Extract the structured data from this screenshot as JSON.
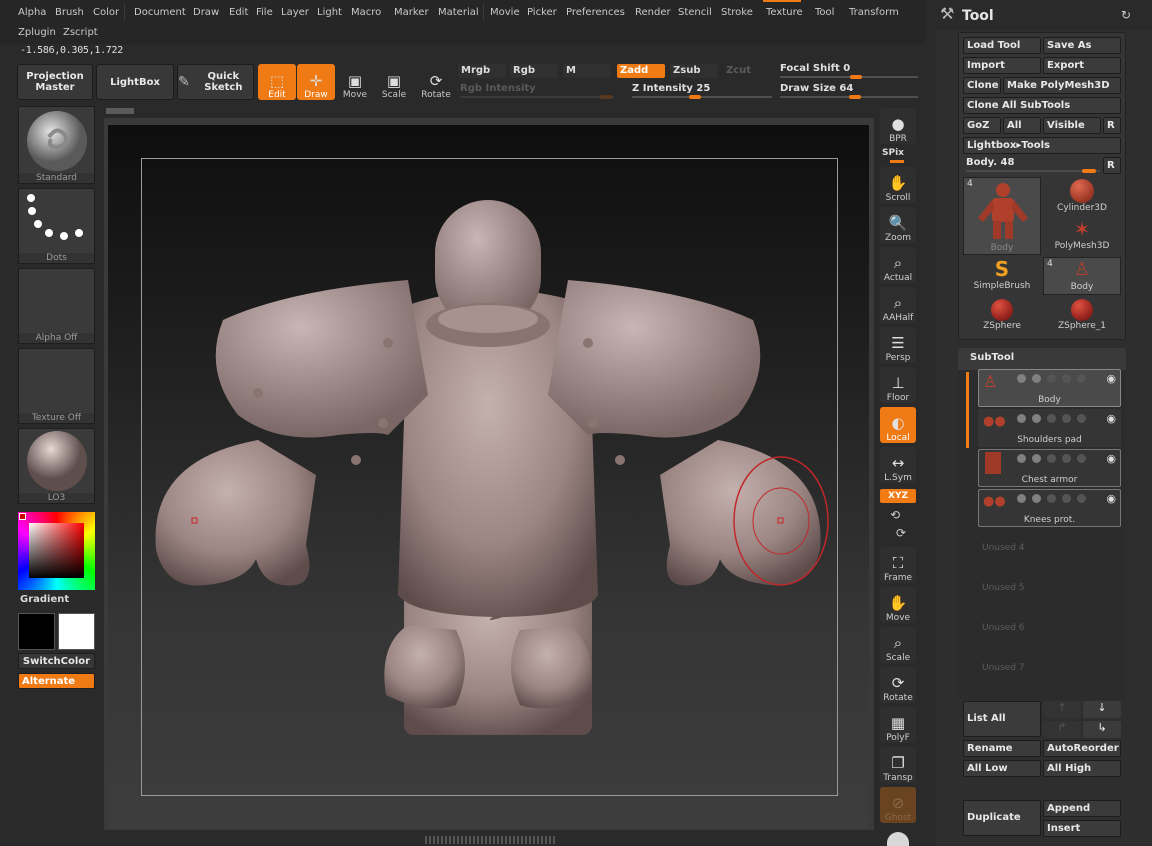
{
  "menu": [
    "Alpha",
    "Brush",
    "Color",
    "Document",
    "Draw",
    "Edit",
    "File",
    "Layer",
    "Light",
    "Macro",
    "Marker",
    "Material",
    "Movie",
    "Picker",
    "Preferences",
    "Render",
    "Stencil",
    "Stroke",
    "Texture",
    "Tool",
    "Transform",
    "Zplugin",
    "Zscript"
  ],
  "coords": "-1.586,0.305,1.722",
  "toolbar": {
    "projection_master": "Projection Master",
    "lightbox": "LightBox",
    "quick_sketch": "Quick Sketch",
    "edit": "Edit",
    "draw": "Draw",
    "move": "Move",
    "scale": "Scale",
    "rotate": "Rotate",
    "mrgb": "Mrgb",
    "rgb": "Rgb",
    "m": "M",
    "zadd": "Zadd",
    "zsub": "Zsub",
    "zcut": "Zcut",
    "rgb_intensity": "Rgb Intensity",
    "z_intensity_label": "Z Intensity",
    "z_intensity_value": "25",
    "focal_shift_label": "Focal Shift",
    "focal_shift_value": "0",
    "draw_size_label": "Draw Size",
    "draw_size_value": "64"
  },
  "left_shelf": {
    "brush": "Standard",
    "stroke": "Dots",
    "alpha": "Alpha Off",
    "texture": "Texture Off",
    "material": "LO3",
    "gradient": "Gradient",
    "switch_color": "SwitchColor",
    "alternate": "Alternate"
  },
  "right_shelf": [
    "BPR",
    "SPix",
    "Scroll",
    "Zoom",
    "Actual",
    "AAHalf",
    "Persp",
    "Floor",
    "Local",
    "L.Sym",
    "XYZ",
    "Frame",
    "Move",
    "Scale",
    "Rotate",
    "PolyF",
    "Transp",
    "Ghost"
  ],
  "tool_panel": {
    "title": "Tool",
    "load_tool": "Load Tool",
    "save_as": "Save As",
    "import": "Import",
    "export": "Export",
    "clone": "Clone",
    "make_polymesh": "Make PolyMesh3D",
    "clone_all": "Clone All SubTools",
    "goz": "GoZ",
    "all": "All",
    "visible": "Visible",
    "r": "R",
    "lightbox_tools": "Lightbox▸Tools",
    "current_tool": "Body. 48",
    "tools": [
      {
        "name": "Body",
        "count": "4"
      },
      {
        "name": "Cylinder3D"
      },
      {
        "name": "PolyMesh3D"
      },
      {
        "name": "SimpleBrush"
      },
      {
        "name": "Body",
        "count": "4"
      },
      {
        "name": "ZSphere"
      },
      {
        "name": "ZSphere_1"
      }
    ],
    "subtool_title": "SubTool",
    "subtools": [
      "Body",
      "Shoulders pad",
      "Chest armor",
      "Knees prot."
    ],
    "unused": [
      "Unused 4",
      "Unused 5",
      "Unused 6",
      "Unused 7"
    ],
    "list_all": "List All",
    "rename": "Rename",
    "auto_reorder": "AutoReorder",
    "all_low": "All Low",
    "all_high": "All High",
    "duplicate": "Duplicate",
    "append": "Append",
    "insert": "Insert"
  },
  "colors": {
    "accent": "#f07a13",
    "model": "#a89290",
    "brush_ring": "#c0282a"
  }
}
